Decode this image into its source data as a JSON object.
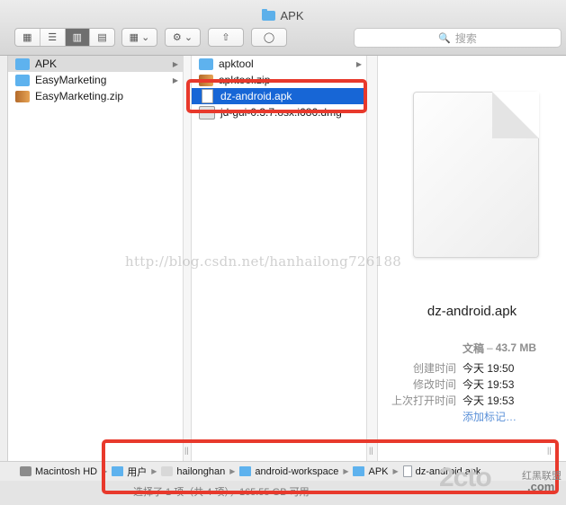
{
  "window": {
    "title": "APK"
  },
  "toolbar": {
    "view_buttons": [
      "icon-view-icon",
      "list-view-icon",
      "column-view-icon",
      "coverflow-view-icon"
    ],
    "arrange_label": "",
    "action_label": "",
    "search_placeholder": "搜索"
  },
  "column1": {
    "items": [
      {
        "label": "APK",
        "type": "folder",
        "selected": true,
        "has_children": true
      },
      {
        "label": "EasyMarketing",
        "type": "folder",
        "selected": false,
        "has_children": true
      },
      {
        "label": "EasyMarketing.zip",
        "type": "zip",
        "selected": false,
        "has_children": false
      }
    ]
  },
  "column2": {
    "items": [
      {
        "label": "apktool",
        "type": "folder",
        "has_children": true
      },
      {
        "label": "apktool.zip",
        "type": "zip"
      },
      {
        "label": "dz-android.apk",
        "type": "doc",
        "selected": true
      },
      {
        "label": "jd-gui-0.3.7.osx.i686.dmg",
        "type": "dmg"
      }
    ]
  },
  "preview": {
    "name": "dz-android.apk",
    "kind": "文稿",
    "size": "43.7 MB",
    "rows": [
      {
        "key": "创建时间",
        "value": "今天 19:50"
      },
      {
        "key": "修改时间",
        "value": "今天 19:53"
      },
      {
        "key": "上次打开时间",
        "value": "今天 19:53"
      }
    ],
    "add_tags": "添加标记…"
  },
  "watermark": "http://blog.csdn.net/hanhailong726188",
  "pathbar": {
    "items": [
      {
        "label": "Macintosh HD",
        "icon": "disk"
      },
      {
        "label": "用户",
        "icon": "folder"
      },
      {
        "label": "hailonghan",
        "icon": "home"
      },
      {
        "label": "android-workspace",
        "icon": "folder"
      },
      {
        "label": "APK",
        "icon": "folder"
      },
      {
        "label": "dz-android.apk",
        "icon": "doc"
      }
    ]
  },
  "statusbar": {
    "text": "选择了 1 项（共 4 项），165.55 GB 可用"
  },
  "logo": {
    "big": "2cto",
    "small": "红黑联盟",
    "com": ".com"
  },
  "colors": {
    "highlight": "#e8392c",
    "selection": "#1766d6",
    "folder": "#5eb2ee"
  }
}
